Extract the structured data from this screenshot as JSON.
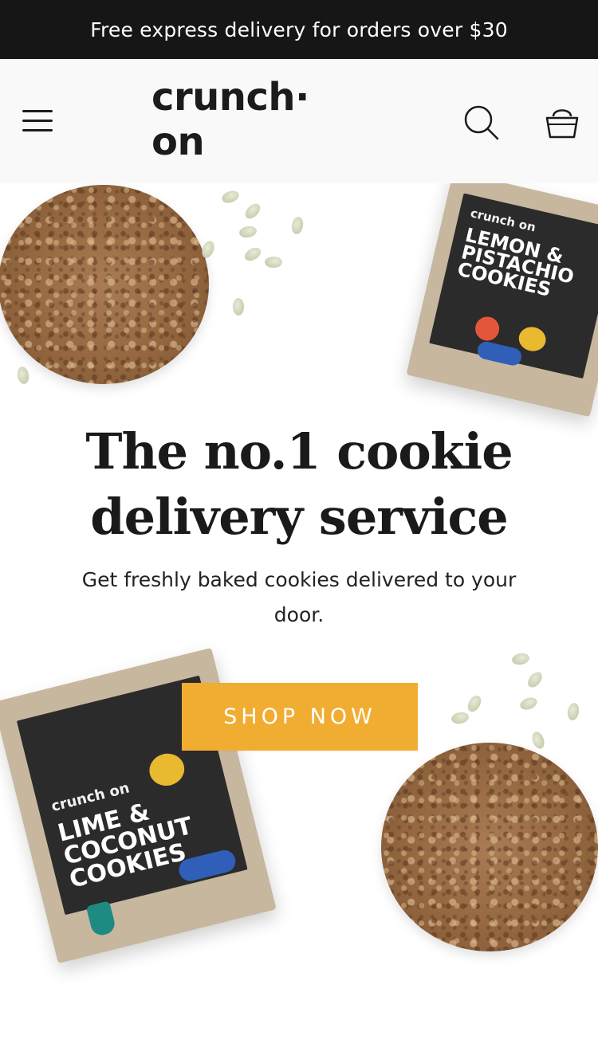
{
  "announcement": {
    "text": "Free express delivery for orders over $30"
  },
  "header": {
    "logo_text": "crunch· on",
    "icons": {
      "menu": "hamburger-menu-icon",
      "search": "search-icon",
      "cart": "shopping-bag-icon"
    }
  },
  "hero": {
    "headline": "The no.1 cookie\ndelivery service",
    "subtext": "Get freshly baked cookies delivered to your door.",
    "cta_label": "SHOP NOW",
    "products": [
      {
        "brand": "crunch on",
        "flavor": "LEMON &\nPISTACHIO\nCOOKIES"
      },
      {
        "brand": "crunch on",
        "flavor": "LIME &\nCOCONUT\nCOOKIES"
      }
    ]
  },
  "colors": {
    "announcement_bg": "#161616",
    "header_bg": "#faf9f9",
    "cta_bg": "#f1ad32",
    "text": "#1a1a1a"
  }
}
